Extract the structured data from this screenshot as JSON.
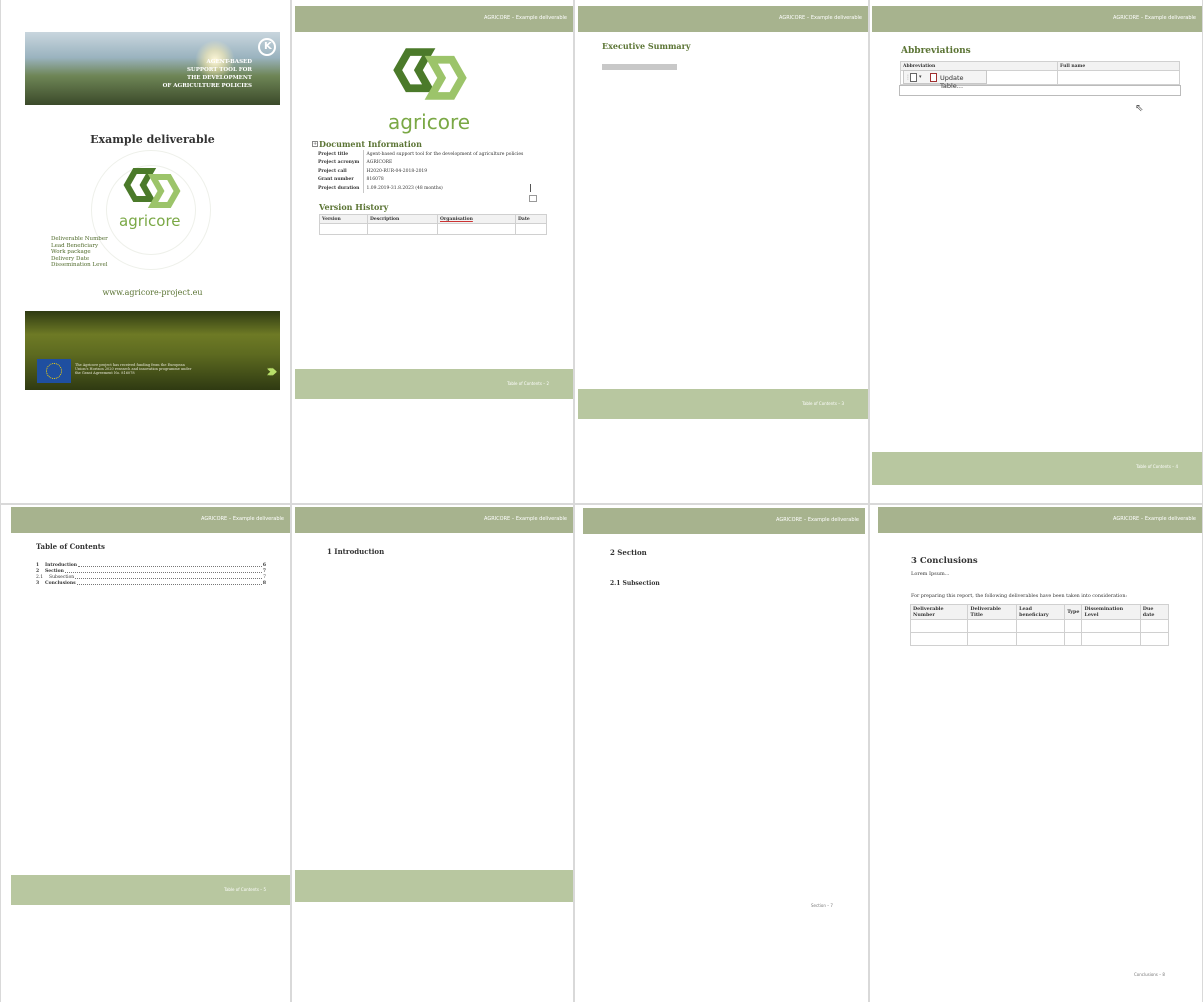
{
  "header_text": "AGRICORE – Example deliverable",
  "cover": {
    "banner_lines": [
      "AGENT-BASED",
      "SUPPORT TOOL FOR",
      "THE DEVELOPMENT",
      "OF AGRICULTURE POLICIES"
    ],
    "k_logo": "K",
    "title": "Example deliverable",
    "logo_word": "agricore",
    "meta_labels": [
      "Deliverable Number",
      "Lead Beneficiary",
      "Work package",
      "Delivery Date",
      "Dissemination Level"
    ],
    "website": "www.agricore-project.eu",
    "eu_text": "The Agricore project has received funding from the European Union's Horizon 2020 research and innovation programme under the Grant Agreement No. 816078"
  },
  "doc_info": {
    "logo_word": "agricore",
    "heading": "Document Information",
    "rows": [
      {
        "key": "Project title",
        "value": "Agent-based support tool for the development of agriculture policies"
      },
      {
        "key": "Project acronym",
        "value": "AGRICORE"
      },
      {
        "key": "Project call",
        "value": "H2020-RUR-04-2018-2019"
      },
      {
        "key": "Grant number",
        "value": "816078"
      },
      {
        "key": "Project duration",
        "value": "1.09.2019-31.8.2023 (48 months)"
      }
    ],
    "version_heading": "Version History",
    "version_columns": [
      "Version",
      "Description",
      "Organisation",
      "Date"
    ],
    "footer": "Table of Contents – 2"
  },
  "exec_summary": {
    "heading": "Executive Summary",
    "footer": "Table of Contents – 3"
  },
  "abbreviations": {
    "heading": "Abbreviations",
    "columns": [
      "Abbreviation",
      "Full name"
    ],
    "update_button": "Update Table...",
    "footer": "Table of Contents – 4"
  },
  "toc": {
    "heading": "Table of Contents",
    "entries": [
      {
        "num": "1",
        "label": "Introduction",
        "page": "6"
      },
      {
        "num": "2",
        "label": "Section",
        "page": "7"
      },
      {
        "num": "2.1",
        "label": "Subsection",
        "page": "7"
      },
      {
        "num": "3",
        "label": "Conclusions",
        "page": "8"
      }
    ],
    "footer": "Table of Contents – 5"
  },
  "intro": {
    "heading": "1   Introduction"
  },
  "section": {
    "heading": "2   Section",
    "subheading": "2.1   Subsection",
    "footer": "Section – 7"
  },
  "conclusions": {
    "heading": "3   Conclusions",
    "body": "Lorem Ipsum...",
    "intro": "For preparing this report, the following deliverables have been taken into consideration:",
    "columns": [
      "Deliverable Number",
      "Deliverable Title",
      "Lead beneficiary",
      "Type",
      "Dissemination Level",
      "Due date"
    ],
    "footer": "Conclusions – 8"
  }
}
